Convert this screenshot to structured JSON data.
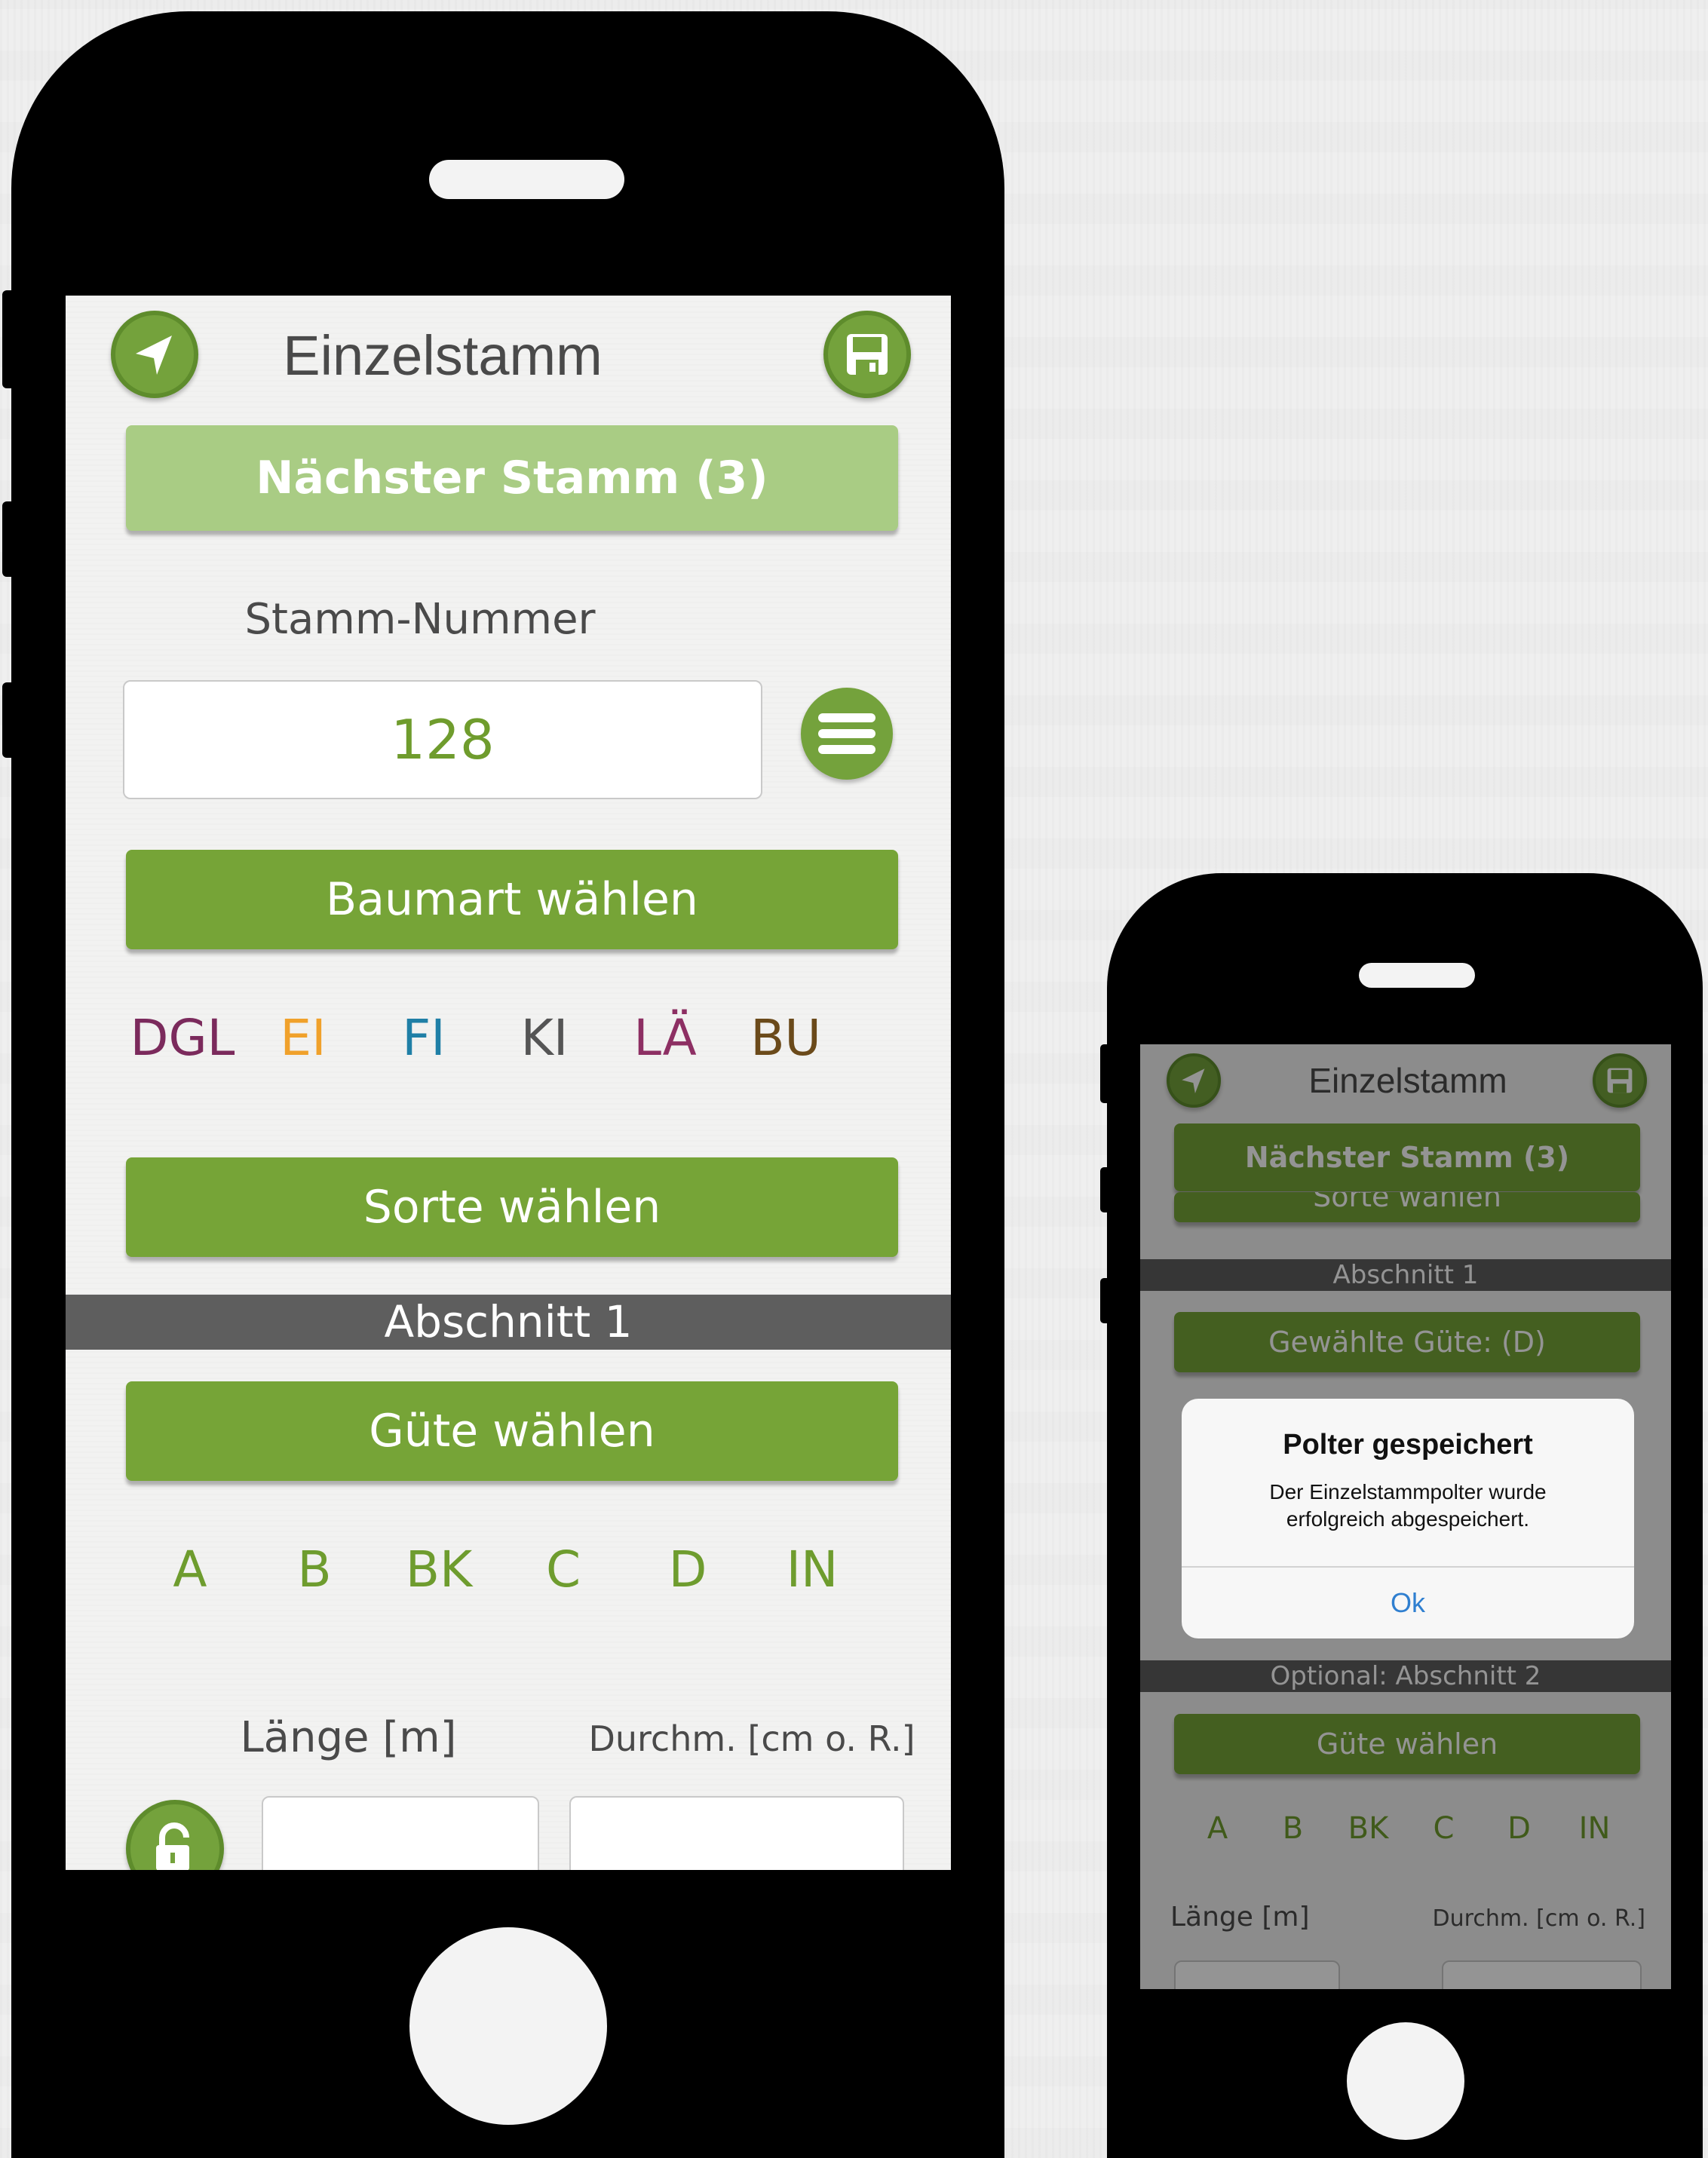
{
  "main_screen": {
    "header": {
      "title": "Einzelstamm",
      "back_icon": "back-arrow-icon",
      "save_icon": "floppy-disk-icon"
    },
    "next_trunk_button": "Nächster Stamm (3)",
    "trunk_number": {
      "label": "Stamm-Nummer",
      "value": "128",
      "menu_icon": "hamburger-menu-icon"
    },
    "species_button": "Baumart wählen",
    "species_options": [
      {
        "label": "DGL",
        "color": "#7b2a5c"
      },
      {
        "label": "EI",
        "color": "#f0a12b"
      },
      {
        "label": "FI",
        "color": "#1f7fa6"
      },
      {
        "label": "KI",
        "color": "#555555"
      },
      {
        "label": "LÄ",
        "color": "#8d2f63"
      },
      {
        "label": "BU",
        "color": "#6b4a1a"
      }
    ],
    "variety_button": "Sorte wählen",
    "section_band": "Abschnitt 1",
    "quality_button": "Güte wählen",
    "quality_options": [
      "A",
      "B",
      "BK",
      "C",
      "D",
      "IN"
    ],
    "length_label": "Länge [m]",
    "diameter_label": "Durchm. [cm o. R.]",
    "length_value": "",
    "diameter_value": "",
    "lock_icon": "unlock-icon"
  },
  "small_screen": {
    "header": {
      "title": "Einzelstamm"
    },
    "next_trunk_button": "Nächster Stamm (3)",
    "variety_button_partial": "Sorte wählen",
    "section_band": "Abschnitt 1",
    "selected_quality_button": "Gewählte Güte: (D)",
    "dialog": {
      "title": "Polter gespeichert",
      "message_line1": "Der Einzelstammpolter wurde",
      "message_line2": "erfolgreich abgespeichert.",
      "ok_button": "Ok"
    },
    "section2_band": "Optional: Abschnitt 2",
    "quality_button": "Güte wählen",
    "quality_options": [
      "A",
      "B",
      "BK",
      "C",
      "D",
      "IN"
    ],
    "length_label": "Länge [m]",
    "diameter_label": "Durchm. [cm o. R.]"
  },
  "colors": {
    "accent_green": "#76a437",
    "light_green": "#a9cc84",
    "quality_green": "#6e9c2e",
    "band_gray": "#5e5e5e",
    "ios_blue": "#2f7fd0"
  }
}
